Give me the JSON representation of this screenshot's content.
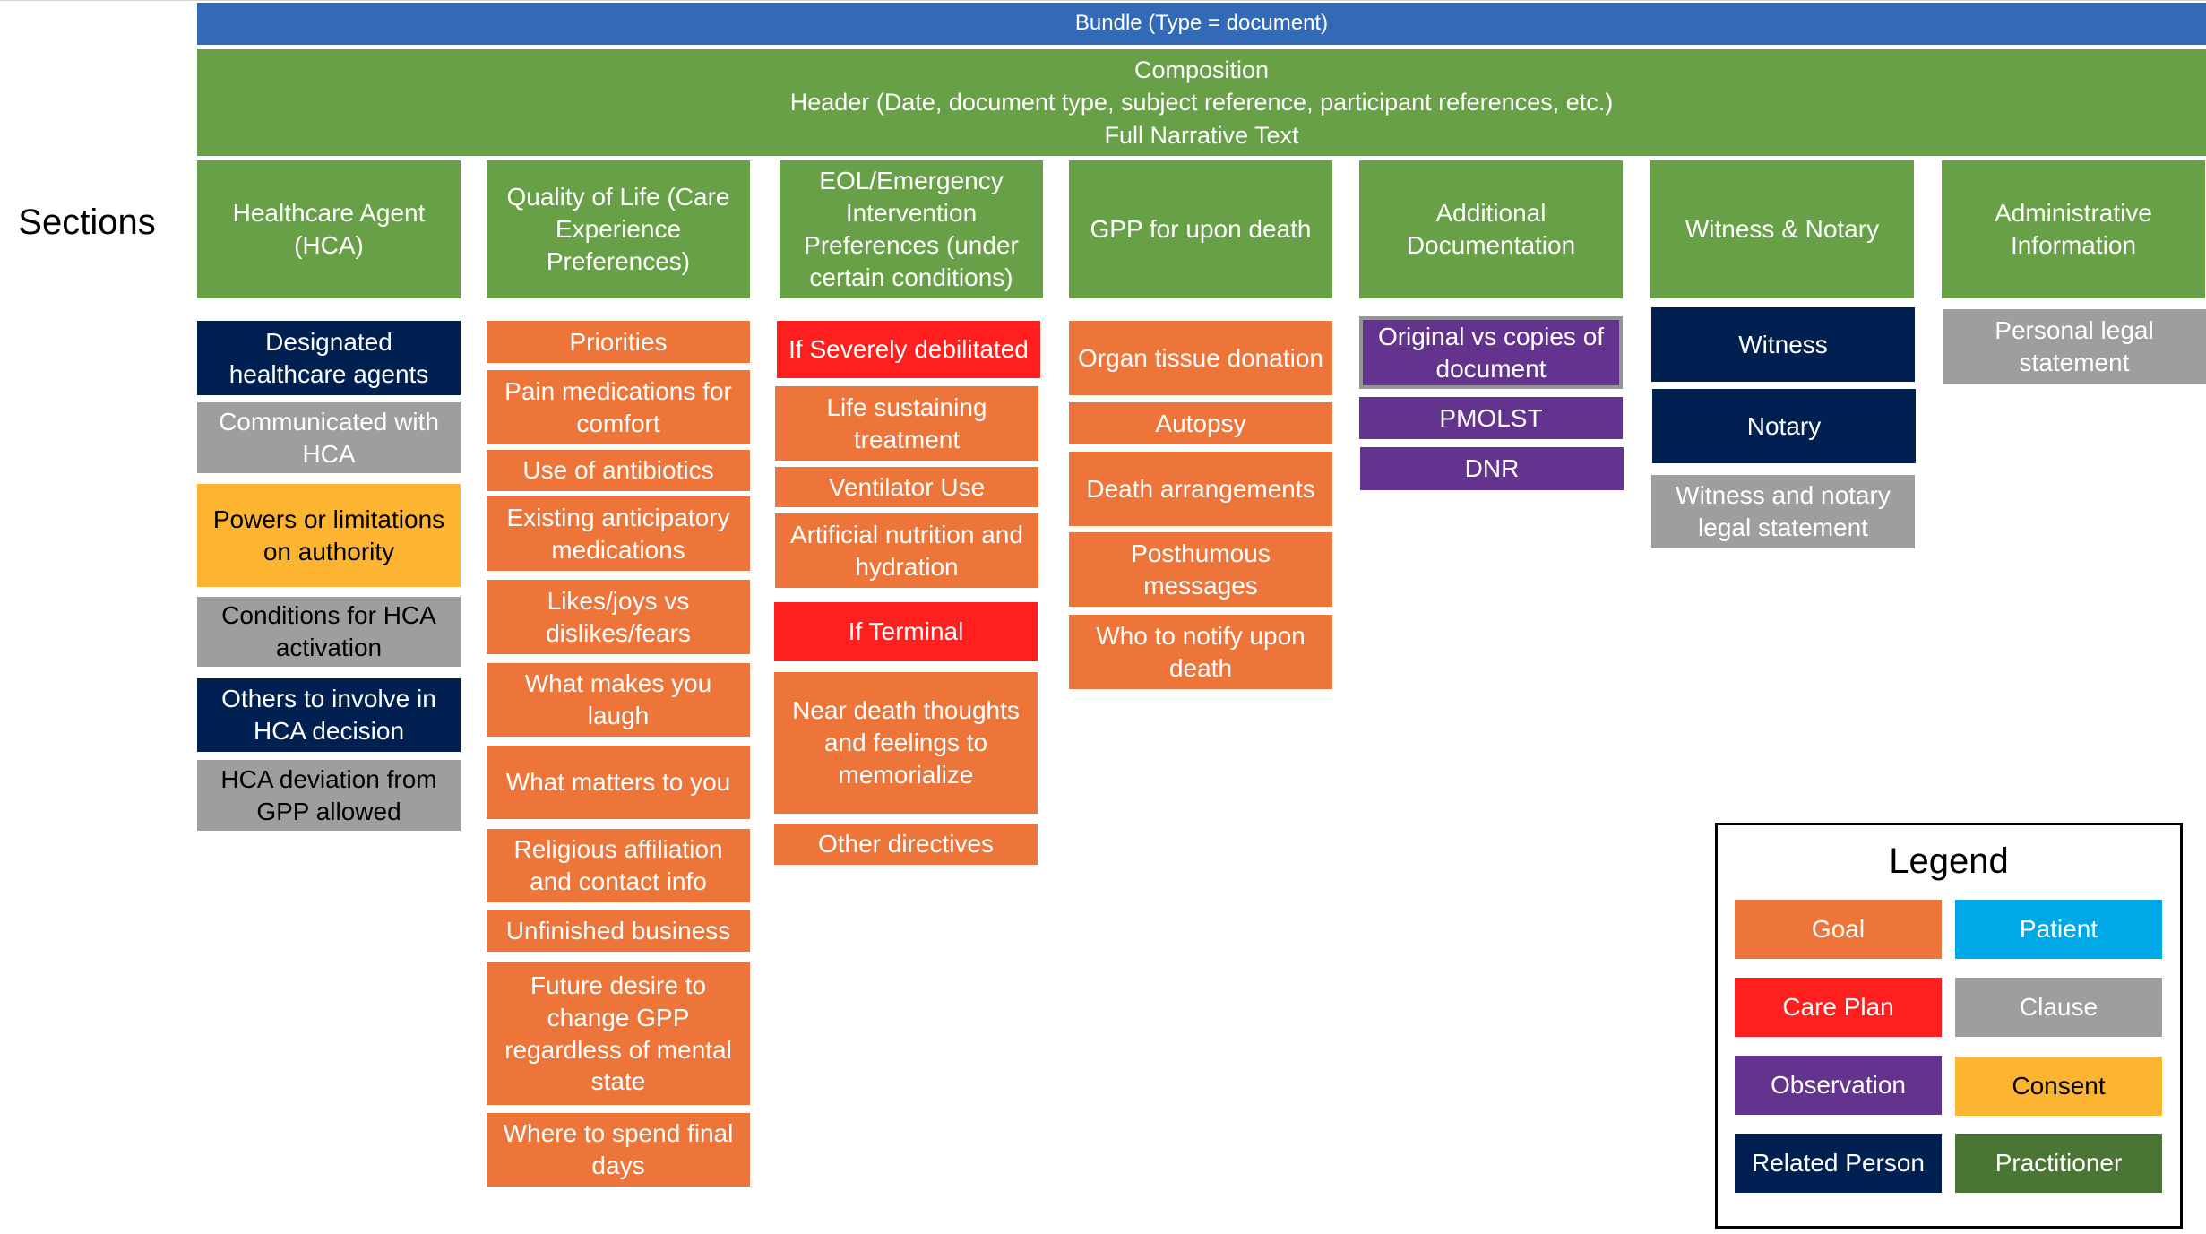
{
  "bundle": {
    "label": "Bundle (Type = document)",
    "color": "#326ab8"
  },
  "composition": {
    "lines": [
      "Composition",
      "Header (Date, document type, subject reference, participant references, etc.)",
      "Full Narrative Text"
    ],
    "color": "#67a047"
  },
  "sections_label": "Sections",
  "sections": [
    {
      "title": "Healthcare Agent (HCA)",
      "items": [
        {
          "label": "Designated healthcare agents",
          "type": "Related Person"
        },
        {
          "label": "Communicated with HCA",
          "type": "Clause"
        },
        {
          "label": "Powers or limitations on authority",
          "type": "Consent"
        },
        {
          "label": "Conditions for HCA activation",
          "type": "Clause"
        },
        {
          "label": "Others to involve in HCA decision",
          "type": "Related Person"
        },
        {
          "label": "HCA deviation from GPP allowed",
          "type": "Clause"
        }
      ]
    },
    {
      "title": "Quality of Life (Care Experience Preferences)",
      "items": [
        {
          "label": "Priorities",
          "type": "Goal"
        },
        {
          "label": "Pain medications for comfort",
          "type": "Goal"
        },
        {
          "label": "Use of antibiotics",
          "type": "Goal"
        },
        {
          "label": "Existing anticipatory medications",
          "type": "Goal"
        },
        {
          "label": "Likes/joys vs dislikes/fears",
          "type": "Goal"
        },
        {
          "label": "What makes you laugh",
          "type": "Goal"
        },
        {
          "label": "What matters to you",
          "type": "Goal"
        },
        {
          "label": "Religious affiliation and contact info",
          "type": "Goal"
        },
        {
          "label": "Unfinished business",
          "type": "Goal"
        },
        {
          "label": "Future desire to change GPP regardless of mental state",
          "type": "Goal"
        },
        {
          "label": "Where to spend final days",
          "type": "Goal"
        }
      ]
    },
    {
      "title": "EOL/Emergency Intervention Preferences (under certain conditions)",
      "items": [
        {
          "label": "If Severely debilitated",
          "type": "Care Plan"
        },
        {
          "label": "Life sustaining treatment",
          "type": "Goal"
        },
        {
          "label": "Ventilator Use",
          "type": "Goal"
        },
        {
          "label": "Artificial nutrition and hydration",
          "type": "Goal"
        },
        {
          "label": "If Terminal",
          "type": "Care Plan"
        },
        {
          "label": "Near death thoughts and feelings to memorialize",
          "type": "Goal"
        },
        {
          "label": "Other directives",
          "type": "Goal"
        }
      ]
    },
    {
      "title": "GPP for upon death",
      "items": [
        {
          "label": "Organ tissue donation",
          "type": "Goal"
        },
        {
          "label": "Autopsy",
          "type": "Goal"
        },
        {
          "label": "Death arrangements",
          "type": "Goal"
        },
        {
          "label": "Posthumous messages",
          "type": "Goal"
        },
        {
          "label": "Who to notify upon death",
          "type": "Goal"
        }
      ]
    },
    {
      "title": "Additional Documentation",
      "items": [
        {
          "label": "Original vs copies of document",
          "type": "Observation"
        },
        {
          "label": "PMOLST",
          "type": "Observation"
        },
        {
          "label": "DNR",
          "type": "Observation"
        }
      ]
    },
    {
      "title": "Witness & Notary",
      "items": [
        {
          "label": "Witness",
          "type": "Related Person"
        },
        {
          "label": "Notary",
          "type": "Related Person"
        },
        {
          "label": "Witness and notary legal statement",
          "type": "Clause"
        }
      ]
    },
    {
      "title": "Administrative Information",
      "items": [
        {
          "label": "Personal legal statement",
          "type": "Clause"
        }
      ]
    }
  ],
  "legend": {
    "title": "Legend",
    "entries": [
      {
        "label": "Goal",
        "color": "#ed7539"
      },
      {
        "label": "Patient",
        "color": "#00a8e5"
      },
      {
        "label": "Care Plan",
        "color": "#ff1f1f"
      },
      {
        "label": "Clause",
        "color": "#9e9e9e"
      },
      {
        "label": "Observation",
        "color": "#64338d"
      },
      {
        "label": "Consent",
        "color": "#fdb431"
      },
      {
        "label": "Related Person",
        "color": "#002052"
      },
      {
        "label": "Practitioner",
        "color": "#4b7534"
      }
    ]
  }
}
